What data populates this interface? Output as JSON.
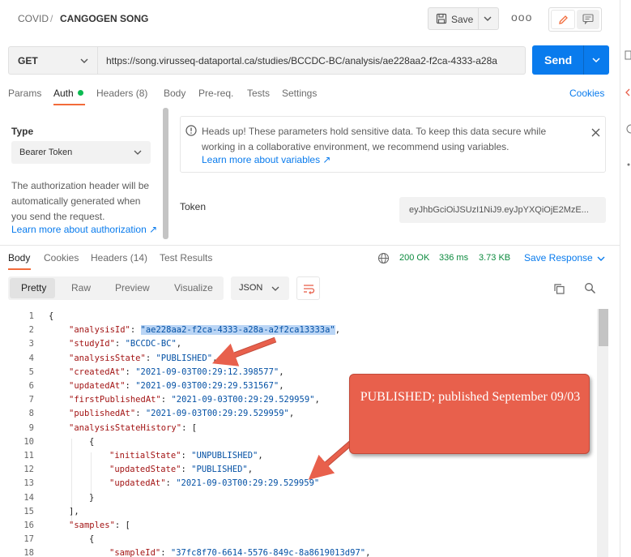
{
  "header": {
    "breadcrumb_parent": "COVID",
    "separator": "/",
    "request_name": "CANGOGEN SONG",
    "save_label": "Save",
    "more_label": "ooo"
  },
  "request": {
    "method": "GET",
    "url": "https://song.virusseq-dataportal.ca/studies/BCCDC-BC/analysis/ae228aa2-f2ca-4333-a28a",
    "send_label": "Send"
  },
  "request_tabs": [
    {
      "label": "Params"
    },
    {
      "label": "Auth"
    },
    {
      "label": "Headers (8)"
    },
    {
      "label": "Body"
    },
    {
      "label": "Pre-req."
    },
    {
      "label": "Tests"
    },
    {
      "label": "Settings"
    }
  ],
  "cookies_label": "Cookies",
  "auth": {
    "type_label": "Type",
    "type_value": "Bearer Token",
    "description": "The authorization header will be automatically generated when you send the request.",
    "learn_more": "Learn more about authorization ↗",
    "notice": "Heads up! These parameters hold sensitive data. To keep this data secure while working in a collaborative environment, we recommend using variables.",
    "notice_link": "Learn more about variables ↗",
    "token_label": "Token",
    "token_value": "eyJhbGciOiJSUzI1NiJ9.eyJpYXQiOjE2MzE..."
  },
  "response_tabs": [
    {
      "label": "Body"
    },
    {
      "label": "Cookies"
    },
    {
      "label": "Headers (14)"
    },
    {
      "label": "Test Results"
    }
  ],
  "response_status": {
    "status": "200 OK",
    "time": "336 ms",
    "size": "3.73 KB",
    "save_label": "Save Response"
  },
  "format_tabs": [
    {
      "label": "Pretty"
    },
    {
      "label": "Raw"
    },
    {
      "label": "Preview"
    },
    {
      "label": "Visualize"
    }
  ],
  "format_select": "JSON",
  "code_lines": [
    {
      "n": "1",
      "indent": 0,
      "key": "",
      "value": "",
      "text": "{"
    },
    {
      "n": "2",
      "indent": 1,
      "key": "\"analysisId\"",
      "value": "\"ae228aa2-f2ca-4333-a28a-a2f2ca13333a\"",
      "text": ","
    },
    {
      "n": "3",
      "indent": 1,
      "key": "\"studyId\"",
      "value": "\"BCCDC-BC\"",
      "text": ","
    },
    {
      "n": "4",
      "indent": 1,
      "key": "\"analysisState\"",
      "value": "\"PUBLISHED\"",
      "text": ","
    },
    {
      "n": "5",
      "indent": 1,
      "key": "\"createdAt\"",
      "value": "\"2021-09-03T00:29:12.398577\"",
      "text": ","
    },
    {
      "n": "6",
      "indent": 1,
      "key": "\"updatedAt\"",
      "value": "\"2021-09-03T00:29:29.531567\"",
      "text": ","
    },
    {
      "n": "7",
      "indent": 1,
      "key": "\"firstPublishedAt\"",
      "value": "\"2021-09-03T00:29:29.529959\"",
      "text": ","
    },
    {
      "n": "8",
      "indent": 1,
      "key": "\"publishedAt\"",
      "value": "\"2021-09-03T00:29:29.529959\"",
      "text": ","
    },
    {
      "n": "9",
      "indent": 1,
      "key": "\"analysisStateHistory\"",
      "value": "",
      "text": ": ["
    },
    {
      "n": "10",
      "indent": 2,
      "key": "",
      "value": "",
      "text": "{"
    },
    {
      "n": "11",
      "indent": 3,
      "key": "\"initialState\"",
      "value": "\"UNPUBLISHED\"",
      "text": ","
    },
    {
      "n": "12",
      "indent": 3,
      "key": "\"updatedState\"",
      "value": "\"PUBLISHED\"",
      "text": ","
    },
    {
      "n": "13",
      "indent": 3,
      "key": "\"updatedAt\"",
      "value": "\"2021-09-03T00:29:29.529959\"",
      "text": ""
    },
    {
      "n": "14",
      "indent": 2,
      "key": "",
      "value": "",
      "text": "}"
    },
    {
      "n": "15",
      "indent": 1,
      "key": "",
      "value": "",
      "text": "],"
    },
    {
      "n": "16",
      "indent": 1,
      "key": "\"samples\"",
      "value": "",
      "text": ": ["
    },
    {
      "n": "17",
      "indent": 2,
      "key": "",
      "value": "",
      "text": "{"
    },
    {
      "n": "18",
      "indent": 3,
      "key": "\"sampleId\"",
      "value": "\"37fc8f70-6614-5576-849c-8a8619013d97\"",
      "text": ","
    }
  ],
  "annotation": {
    "text": "PUBLISHED; published September 09/03"
  },
  "colors": {
    "accent": "#097bed",
    "tab_active": "#f26b3a",
    "status_ok": "#0c8a3e",
    "json_key": "#a31515",
    "json_string": "#0451a5",
    "callout": "#e8604c"
  }
}
